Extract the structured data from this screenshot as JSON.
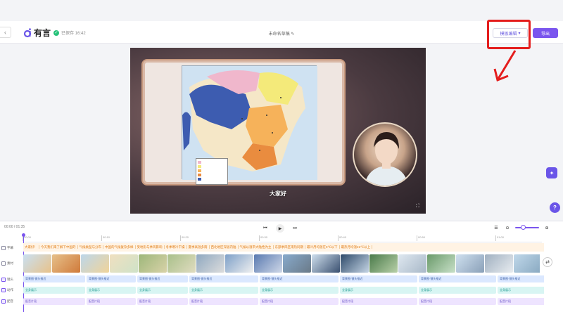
{
  "header": {
    "logo_text": "有言",
    "saved_status": "已保存 16:42",
    "doc_title": "未命名草稿",
    "mode_button": "模板编辑",
    "export_button": "导出"
  },
  "preview": {
    "caption": "大家好"
  },
  "timeline": {
    "time_readout": "00:00 / 01:35",
    "ruler_ticks": [
      "00:00",
      "00:10",
      "00:20",
      "00:30",
      "00:40",
      "00:50",
      "01:00"
    ],
    "track_labels": [
      "字幕",
      "素材",
      "镜头",
      "动作",
      "配音"
    ],
    "subtitles": [
      "大家好！",
      "今天我们来了解下中国的",
      "气候类型与分布",
      "中国的气候复杂多样",
      "受地形与季风影响",
      "冬季寒冷干燥",
      "夏季高温多雨",
      "西北地区深居内陆",
      "气候以温带大陆性为主",
      "东部季风区雨热同期",
      "最冷月均温在0℃以下",
      "最热月均温22℃以上"
    ],
    "camera_clip_label": "背景图·镜头推近",
    "action_clip_label": "全身展示",
    "voice_clip_label": "配音片段"
  },
  "colors": {
    "accent": "#7a55ee",
    "highlight": "#e41d1d",
    "subtitle": "#e07a10"
  },
  "icons": {
    "back": "chevron-left-icon",
    "saved": "check-circle-icon",
    "edit": "pencil-icon",
    "fullscreen": "expand-icon",
    "ai": "ai-assistant-icon",
    "help": "help-icon"
  }
}
